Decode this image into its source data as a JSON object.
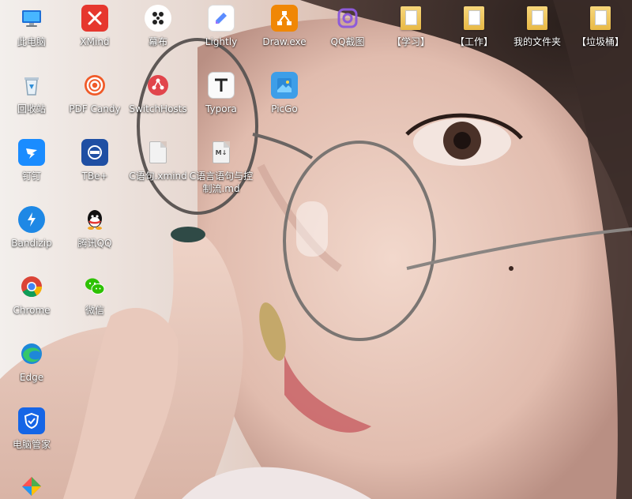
{
  "desktop": {
    "icons": [
      {
        "id": "this-pc",
        "label": "此电脑",
        "icon": "computer-icon"
      },
      {
        "id": "xmind",
        "label": "XMind",
        "icon": "xmind-icon"
      },
      {
        "id": "mubu",
        "label": "幕布",
        "icon": "mubu-icon"
      },
      {
        "id": "lightly",
        "label": "Lightly",
        "icon": "lightly-icon"
      },
      {
        "id": "drawio",
        "label": "Draw.exe",
        "icon": "drawio-icon"
      },
      {
        "id": "qq-screenshot",
        "label": "QQ截图",
        "icon": "camera-icon"
      },
      {
        "id": "study",
        "label": "【学习】",
        "icon": "folder-icon"
      },
      {
        "id": "work",
        "label": "【工作】",
        "icon": "folder-icon"
      },
      {
        "id": "my-files",
        "label": "我的文件夹",
        "icon": "folder-icon"
      },
      {
        "id": "trash-folder",
        "label": "【垃圾桶】",
        "icon": "folder-icon"
      },
      {
        "id": "recycle-bin",
        "label": "回收站",
        "icon": "recycle-bin-icon"
      },
      {
        "id": "pdf-candy",
        "label": "PDF Candy",
        "icon": "pdf-candy-icon"
      },
      {
        "id": "switchhosts",
        "label": "SwitchHosts",
        "icon": "switchhosts-icon"
      },
      {
        "id": "typora",
        "label": "Typora",
        "icon": "typora-icon"
      },
      {
        "id": "picgo",
        "label": "PicGo",
        "icon": "picgo-icon"
      },
      {
        "id": "dingtalk",
        "label": "钉钉",
        "icon": "dingtalk-icon"
      },
      {
        "id": "tbe",
        "label": "TBe+",
        "icon": "tbe-icon"
      },
      {
        "id": "c-xmind",
        "label": "C语句.xmind",
        "icon": "file-icon"
      },
      {
        "id": "c-md",
        "label": "C语言语句与控制流.md",
        "icon": "markdown-file-icon"
      },
      {
        "id": "bandizip",
        "label": "Bandizip",
        "icon": "bandizip-icon"
      },
      {
        "id": "tencent-qq",
        "label": "腾讯QQ",
        "icon": "qq-icon"
      },
      {
        "id": "chrome",
        "label": "Chrome",
        "icon": "chrome-icon"
      },
      {
        "id": "wechat",
        "label": "微信",
        "icon": "wechat-icon"
      },
      {
        "id": "edge",
        "label": "Edge",
        "icon": "edge-icon"
      },
      {
        "id": "pc-manager",
        "label": "电脑管家",
        "icon": "shield-icon"
      },
      {
        "id": "partial-app",
        "label": "",
        "icon": "colorful-app-icon"
      }
    ]
  },
  "colors": {
    "xmind": "#e6372e",
    "drawio": "#f08705",
    "pdf_candy": "#f05a28",
    "switchhosts": "#e1454c",
    "dingtalk": "#1a8cff",
    "tbe": "#1f4fa3",
    "bandizip": "#1e88e5",
    "pc_manager": "#1565e6"
  }
}
